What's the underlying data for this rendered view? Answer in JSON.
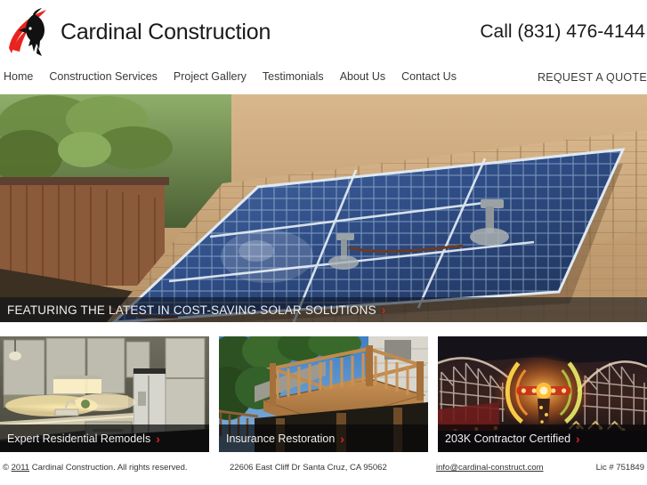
{
  "header": {
    "brand_name": "Cardinal Construction",
    "logo_icon": "cardinal-bird-logo",
    "logo_red": "#e8231f",
    "logo_black": "#111111",
    "phone": "Call (831) 476-4144"
  },
  "nav": {
    "items": [
      {
        "label": "Home"
      },
      {
        "label": "Construction Services"
      },
      {
        "label": "Project Gallery"
      },
      {
        "label": "Testimonials"
      },
      {
        "label": "About Us"
      },
      {
        "label": "Contact Us"
      }
    ],
    "quote_label": "REQUEST A QUOTE"
  },
  "hero": {
    "image_description": "rooftop solar photovoltaic panel array mounted on tan asphalt shingle roof with wooden fence and trees behind",
    "caption": "FEATURING THE LATEST IN COST-SAVING SOLAR SOLUTIONS",
    "arrow": "›"
  },
  "cards": [
    {
      "caption": "Expert Residential Remodels",
      "arrow": "›",
      "image_description": "remodeled kitchen with white cabinetry, warm under-cabinet lighting and refrigerator"
    },
    {
      "caption": "Insurance Restoration",
      "arrow": "›",
      "image_description": "elevated wooden deck with railing against house, blue sky and green trees"
    },
    {
      "caption": "203K Contractor Certified",
      "arrow": "›",
      "image_description": "nighttime seaside boardwalk amusement park with illuminated spinning ride and wooden roller coaster"
    }
  ],
  "footer": {
    "copyright_prefix": "© ",
    "copyright_year": "2011",
    "copyright_suffix": " Cardinal Construction. All rights reserved.",
    "address": "22606 East Cliff Dr Santa Cruz, CA 95062",
    "email": "info@cardinal-construct.com",
    "license": "Lic # 751849"
  },
  "colors": {
    "accent_red": "#e02020",
    "text": "#333333",
    "background": "#ffffff",
    "caption_overlay": "rgba(8,8,10,0.72)"
  }
}
